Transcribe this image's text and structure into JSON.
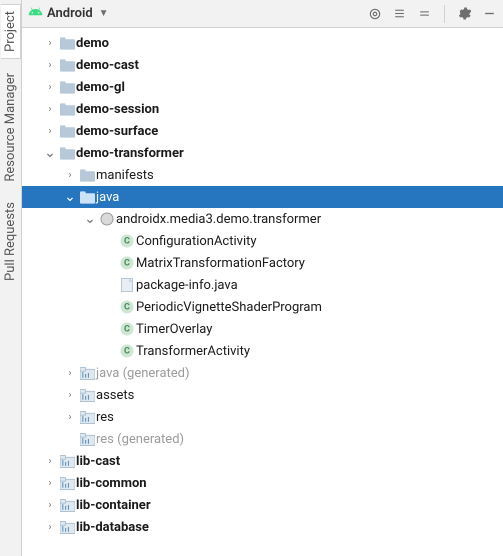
{
  "header": {
    "title": "Android"
  },
  "side_tabs": [
    {
      "label": "Project",
      "active": true
    },
    {
      "label": "Resource Manager",
      "active": false
    },
    {
      "label": "Pull Requests",
      "active": false
    }
  ],
  "tree": [
    {
      "depth": 0,
      "chev": "right",
      "icon": "folder",
      "label": "demo",
      "bold": true
    },
    {
      "depth": 0,
      "chev": "right",
      "icon": "folder",
      "label": "demo-cast",
      "bold": true
    },
    {
      "depth": 0,
      "chev": "right",
      "icon": "folder",
      "label": "demo-gl",
      "bold": true
    },
    {
      "depth": 0,
      "chev": "right",
      "icon": "folder",
      "label": "demo-session",
      "bold": true
    },
    {
      "depth": 0,
      "chev": "right",
      "icon": "folder",
      "label": "demo-surface",
      "bold": true
    },
    {
      "depth": 0,
      "chev": "down",
      "icon": "folder",
      "label": "demo-transformer",
      "bold": true
    },
    {
      "depth": 1,
      "chev": "right",
      "icon": "folder",
      "label": "manifests"
    },
    {
      "depth": 1,
      "chev": "down",
      "icon": "src",
      "label": "java",
      "selected": true
    },
    {
      "depth": 2,
      "chev": "down",
      "icon": "pkg",
      "label": "androidx.media3.demo.transformer"
    },
    {
      "depth": 3,
      "chev": "none",
      "icon": "class",
      "label": "ConfigurationActivity"
    },
    {
      "depth": 3,
      "chev": "none",
      "icon": "class",
      "label": "MatrixTransformationFactory"
    },
    {
      "depth": 3,
      "chev": "none",
      "icon": "file",
      "label": "package-info.java"
    },
    {
      "depth": 3,
      "chev": "none",
      "icon": "class",
      "label": "PeriodicVignetteShaderProgram"
    },
    {
      "depth": 3,
      "chev": "none",
      "icon": "class",
      "label": "TimerOverlay"
    },
    {
      "depth": 3,
      "chev": "none",
      "icon": "class",
      "label": "TransformerActivity"
    },
    {
      "depth": 1,
      "chev": "right",
      "icon": "module",
      "label": "java",
      "suffix": " (generated)",
      "dim": true
    },
    {
      "depth": 1,
      "chev": "right",
      "icon": "module",
      "label": "assets"
    },
    {
      "depth": 1,
      "chev": "right",
      "icon": "module",
      "label": "res"
    },
    {
      "depth": 1,
      "chev": "none",
      "icon": "module",
      "label": "res",
      "suffix": " (generated)",
      "dim": true
    },
    {
      "depth": 0,
      "chev": "right",
      "icon": "module",
      "label": "lib-cast",
      "bold": true
    },
    {
      "depth": 0,
      "chev": "right",
      "icon": "module",
      "label": "lib-common",
      "bold": true
    },
    {
      "depth": 0,
      "chev": "right",
      "icon": "module",
      "label": "lib-container",
      "bold": true
    },
    {
      "depth": 0,
      "chev": "right",
      "icon": "module",
      "label": "lib-database",
      "bold": true
    }
  ]
}
